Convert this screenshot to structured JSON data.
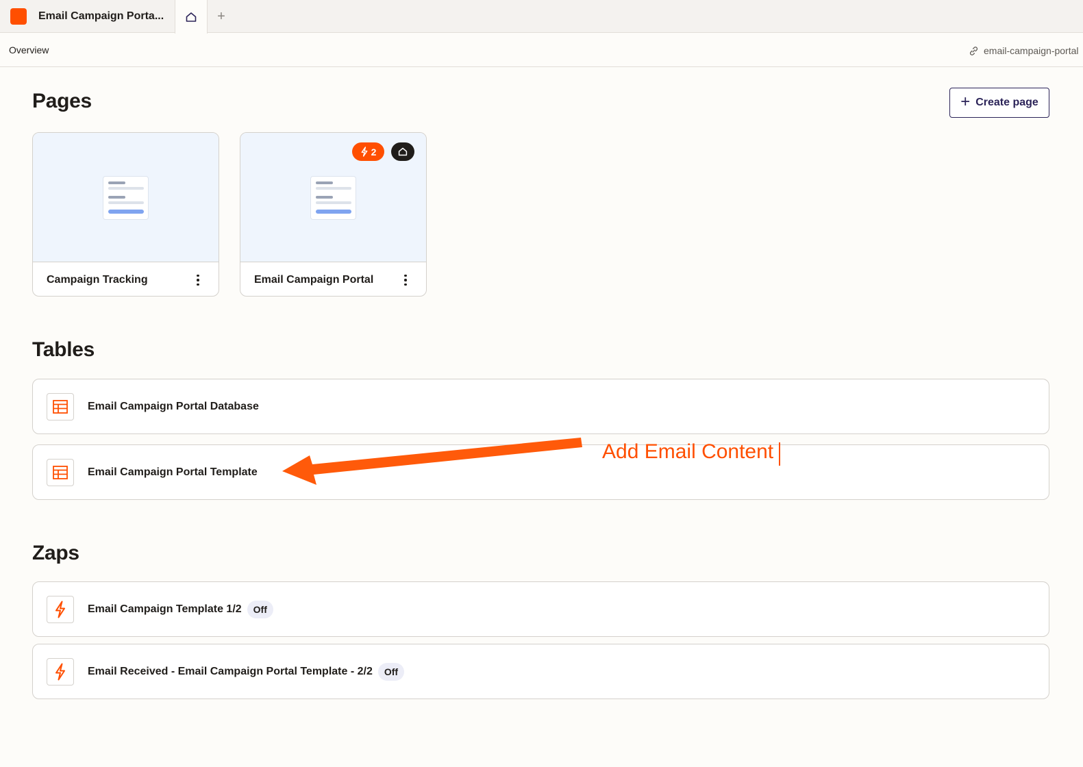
{
  "tabbar": {
    "app_title": "Email Campaign Porta...",
    "add_tab_symbol": "+"
  },
  "subheader": {
    "breadcrumb": "Overview",
    "url_slug": "email-campaign-portal"
  },
  "pages": {
    "heading": "Pages",
    "create_label": "Create page",
    "cards": [
      {
        "name": "Campaign Tracking"
      },
      {
        "name": "Email Campaign Portal",
        "zap_count": "2",
        "is_home": true
      }
    ]
  },
  "tables": {
    "heading": "Tables",
    "items": [
      {
        "label": "Email Campaign Portal Database"
      },
      {
        "label": "Email Campaign Portal Template"
      }
    ]
  },
  "zaps": {
    "heading": "Zaps",
    "items": [
      {
        "label": "Email Campaign Template 1/2",
        "status": "Off"
      },
      {
        "label": "Email Received - Email Campaign Portal Template - 2/2",
        "status": "Off"
      }
    ]
  },
  "annotation": {
    "text": "Add Email Content"
  },
  "icons": {
    "app_logo": "orange-square",
    "home_tab": "home-icon",
    "link": "link-icon",
    "table": "table-icon",
    "zap": "lightning-bolt-icon",
    "more": "kebab-menu-icon"
  },
  "colors": {
    "brand": "#ff4f00",
    "accent_navy": "#2b2358",
    "background": "#fdfcf9",
    "thumbnail_bg": "#eff5fd",
    "pill_bg": "#ecedf7"
  }
}
